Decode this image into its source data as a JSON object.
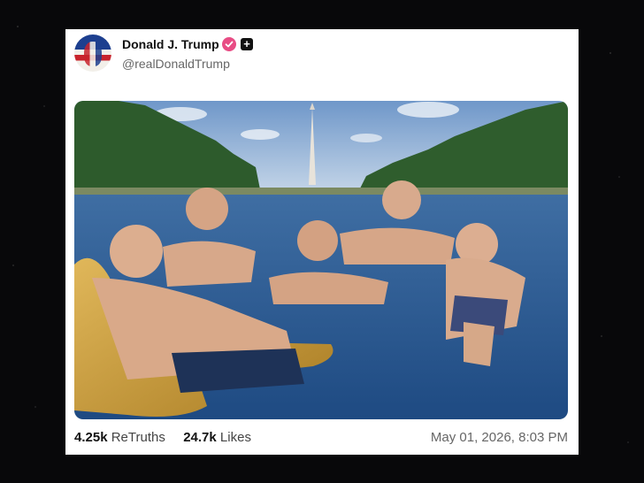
{
  "post": {
    "author_name": "Donald J. Trump",
    "author_handle": "@realDonaldTrump",
    "retruths_count": "4.25k",
    "retruths_label": "ReTruths",
    "likes_count": "24.7k",
    "likes_label": "Likes",
    "timestamp": "May 01, 2026, 8:03 PM"
  },
  "icons": {
    "verified": "verified-badge-icon",
    "add": "plus-icon"
  },
  "colors": {
    "verified_badge": "#e84c84",
    "card_background": "#ffffff",
    "page_background": "#08080a"
  }
}
